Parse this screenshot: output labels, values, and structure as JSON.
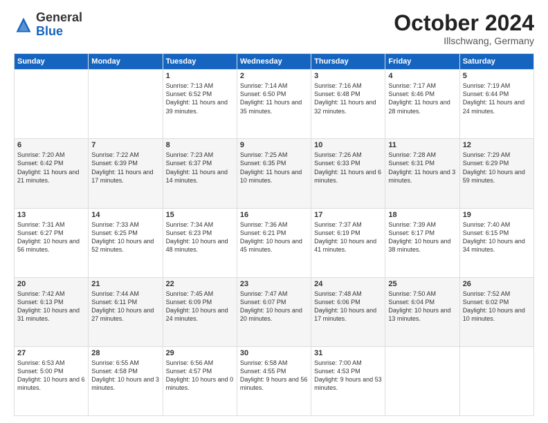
{
  "header": {
    "logo_general": "General",
    "logo_blue": "Blue",
    "month": "October 2024",
    "location": "Illschwang, Germany"
  },
  "weekdays": [
    "Sunday",
    "Monday",
    "Tuesday",
    "Wednesday",
    "Thursday",
    "Friday",
    "Saturday"
  ],
  "weeks": [
    [
      {
        "day": "",
        "text": ""
      },
      {
        "day": "",
        "text": ""
      },
      {
        "day": "1",
        "text": "Sunrise: 7:13 AM\nSunset: 6:52 PM\nDaylight: 11 hours and 39 minutes."
      },
      {
        "day": "2",
        "text": "Sunrise: 7:14 AM\nSunset: 6:50 PM\nDaylight: 11 hours and 35 minutes."
      },
      {
        "day": "3",
        "text": "Sunrise: 7:16 AM\nSunset: 6:48 PM\nDaylight: 11 hours and 32 minutes."
      },
      {
        "day": "4",
        "text": "Sunrise: 7:17 AM\nSunset: 6:46 PM\nDaylight: 11 hours and 28 minutes."
      },
      {
        "day": "5",
        "text": "Sunrise: 7:19 AM\nSunset: 6:44 PM\nDaylight: 11 hours and 24 minutes."
      }
    ],
    [
      {
        "day": "6",
        "text": "Sunrise: 7:20 AM\nSunset: 6:42 PM\nDaylight: 11 hours and 21 minutes."
      },
      {
        "day": "7",
        "text": "Sunrise: 7:22 AM\nSunset: 6:39 PM\nDaylight: 11 hours and 17 minutes."
      },
      {
        "day": "8",
        "text": "Sunrise: 7:23 AM\nSunset: 6:37 PM\nDaylight: 11 hours and 14 minutes."
      },
      {
        "day": "9",
        "text": "Sunrise: 7:25 AM\nSunset: 6:35 PM\nDaylight: 11 hours and 10 minutes."
      },
      {
        "day": "10",
        "text": "Sunrise: 7:26 AM\nSunset: 6:33 PM\nDaylight: 11 hours and 6 minutes."
      },
      {
        "day": "11",
        "text": "Sunrise: 7:28 AM\nSunset: 6:31 PM\nDaylight: 11 hours and 3 minutes."
      },
      {
        "day": "12",
        "text": "Sunrise: 7:29 AM\nSunset: 6:29 PM\nDaylight: 10 hours and 59 minutes."
      }
    ],
    [
      {
        "day": "13",
        "text": "Sunrise: 7:31 AM\nSunset: 6:27 PM\nDaylight: 10 hours and 56 minutes."
      },
      {
        "day": "14",
        "text": "Sunrise: 7:33 AM\nSunset: 6:25 PM\nDaylight: 10 hours and 52 minutes."
      },
      {
        "day": "15",
        "text": "Sunrise: 7:34 AM\nSunset: 6:23 PM\nDaylight: 10 hours and 48 minutes."
      },
      {
        "day": "16",
        "text": "Sunrise: 7:36 AM\nSunset: 6:21 PM\nDaylight: 10 hours and 45 minutes."
      },
      {
        "day": "17",
        "text": "Sunrise: 7:37 AM\nSunset: 6:19 PM\nDaylight: 10 hours and 41 minutes."
      },
      {
        "day": "18",
        "text": "Sunrise: 7:39 AM\nSunset: 6:17 PM\nDaylight: 10 hours and 38 minutes."
      },
      {
        "day": "19",
        "text": "Sunrise: 7:40 AM\nSunset: 6:15 PM\nDaylight: 10 hours and 34 minutes."
      }
    ],
    [
      {
        "day": "20",
        "text": "Sunrise: 7:42 AM\nSunset: 6:13 PM\nDaylight: 10 hours and 31 minutes."
      },
      {
        "day": "21",
        "text": "Sunrise: 7:44 AM\nSunset: 6:11 PM\nDaylight: 10 hours and 27 minutes."
      },
      {
        "day": "22",
        "text": "Sunrise: 7:45 AM\nSunset: 6:09 PM\nDaylight: 10 hours and 24 minutes."
      },
      {
        "day": "23",
        "text": "Sunrise: 7:47 AM\nSunset: 6:07 PM\nDaylight: 10 hours and 20 minutes."
      },
      {
        "day": "24",
        "text": "Sunrise: 7:48 AM\nSunset: 6:06 PM\nDaylight: 10 hours and 17 minutes."
      },
      {
        "day": "25",
        "text": "Sunrise: 7:50 AM\nSunset: 6:04 PM\nDaylight: 10 hours and 13 minutes."
      },
      {
        "day": "26",
        "text": "Sunrise: 7:52 AM\nSunset: 6:02 PM\nDaylight: 10 hours and 10 minutes."
      }
    ],
    [
      {
        "day": "27",
        "text": "Sunrise: 6:53 AM\nSunset: 5:00 PM\nDaylight: 10 hours and 6 minutes."
      },
      {
        "day": "28",
        "text": "Sunrise: 6:55 AM\nSunset: 4:58 PM\nDaylight: 10 hours and 3 minutes."
      },
      {
        "day": "29",
        "text": "Sunrise: 6:56 AM\nSunset: 4:57 PM\nDaylight: 10 hours and 0 minutes."
      },
      {
        "day": "30",
        "text": "Sunrise: 6:58 AM\nSunset: 4:55 PM\nDaylight: 9 hours and 56 minutes."
      },
      {
        "day": "31",
        "text": "Sunrise: 7:00 AM\nSunset: 4:53 PM\nDaylight: 9 hours and 53 minutes."
      },
      {
        "day": "",
        "text": ""
      },
      {
        "day": "",
        "text": ""
      }
    ]
  ]
}
